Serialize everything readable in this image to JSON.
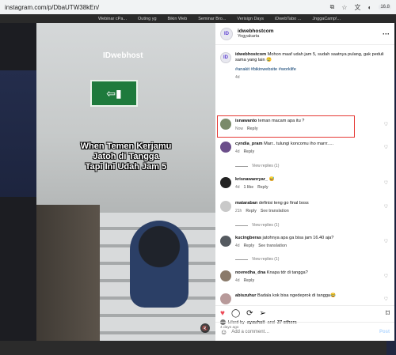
{
  "browser": {
    "url": "instagram.com/p/DbaUTW38kEn/",
    "badge": "16.8"
  },
  "bookmarks": [
    "Webinar cPa...",
    "Outing yg",
    "Bikin Web",
    "Seminar Bro...",
    "Verisign Days",
    "iDwebTabo ...",
    "JnggaCamp!..."
  ],
  "media": {
    "logo": "IDwebhost",
    "caption_lines": [
      "When Temen Kerjamu",
      "Jatoh di Tangga",
      "Tapi Ini Udah Jam 5"
    ]
  },
  "post": {
    "username": "idwebhostcom",
    "location": "Yogyakarta",
    "caption_user": "idwebhostcom",
    "caption_text": "Mohon maaf udah jam 5, sudah saatnya pulang, gak peduli sama yang lain 😢",
    "hashtags": "#anakit #bikinwebsite #worklife",
    "caption_time": "4d"
  },
  "comments": [
    {
      "user": "isnawanto",
      "text": "teman macam apa itu ?",
      "time": "Now",
      "reply": "Reply",
      "translate": "",
      "color": "#7a8a6a"
    },
    {
      "user": "cyndia_pram",
      "text": "Marr.. tulungi koncomu iho marrr.....",
      "time": "4d",
      "reply": "Reply",
      "translate": "",
      "color": "#6b4e8a",
      "replies": "View replies (1)"
    },
    {
      "user": "krisnawanryar_",
      "text": "😅",
      "time": "4d",
      "likes": "1 like",
      "reply": "Reply",
      "translate": "",
      "color": "#222222"
    },
    {
      "user": "mataraban",
      "text": "definisi teng go final boss",
      "time": "21h",
      "reply": "Reply",
      "translate": "See translation",
      "color": "#c9c9c9",
      "replies": "View replies (1)"
    },
    {
      "user": "kucingberas",
      "text": "jatohnya apa ga bisa jam 16.40 aja?",
      "time": "4d",
      "reply": "Reply",
      "translate": "See translation",
      "color": "#555a60",
      "replies": "View replies (1)"
    },
    {
      "user": "novredha_dna",
      "text": "Knapa tdr di tangga?",
      "time": "4d",
      "reply": "Reply",
      "translate": "",
      "color": "#8a7a6a"
    },
    {
      "user": "abiszuhur",
      "text": "Badala kok bisa ngedeprok di tangga😂",
      "color": "#b89a9a"
    }
  ],
  "footer": {
    "liked_by_prefix": "Liked by",
    "liked_user": "ayauhuii",
    "liked_and": "and",
    "liked_count": "37 others",
    "date": "4 days ago",
    "add_comment_placeholder": "Add a comment…",
    "post_label": "Post"
  }
}
